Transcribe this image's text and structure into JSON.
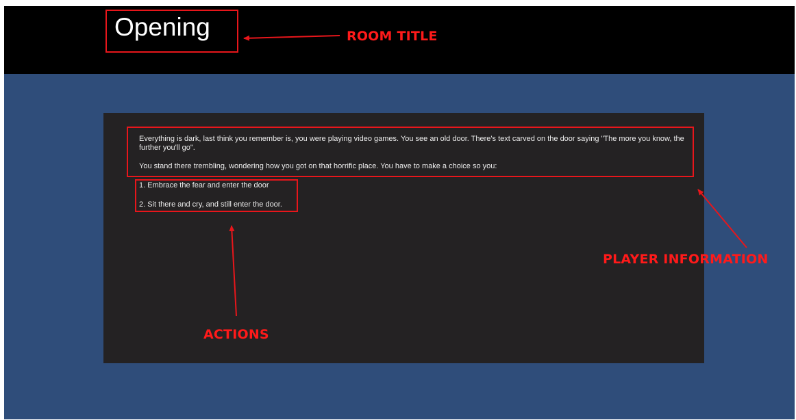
{
  "room": {
    "title": "Opening"
  },
  "story": {
    "paragraphs": [
      "Everything is dark, last think you remember is, you were playing video games. You see an old door. There's text carved on the door saying \"The more you know, the further you'll go\".",
      "You stand there trembling, wondering how you got on that horrific place. You have to make a choice so you:"
    ],
    "actions": [
      "1. Embrace the fear and enter the door",
      "2. Sit there and cry, and still enter the door."
    ]
  },
  "annotations": {
    "room_title": "ROOM TITLE",
    "player_information": "PLAYER INFORMATION",
    "actions": "ACTIONS"
  },
  "colors": {
    "background": "#2f4d7a",
    "header": "#000000",
    "panel": "#242223",
    "annotation": "#e8161b"
  }
}
